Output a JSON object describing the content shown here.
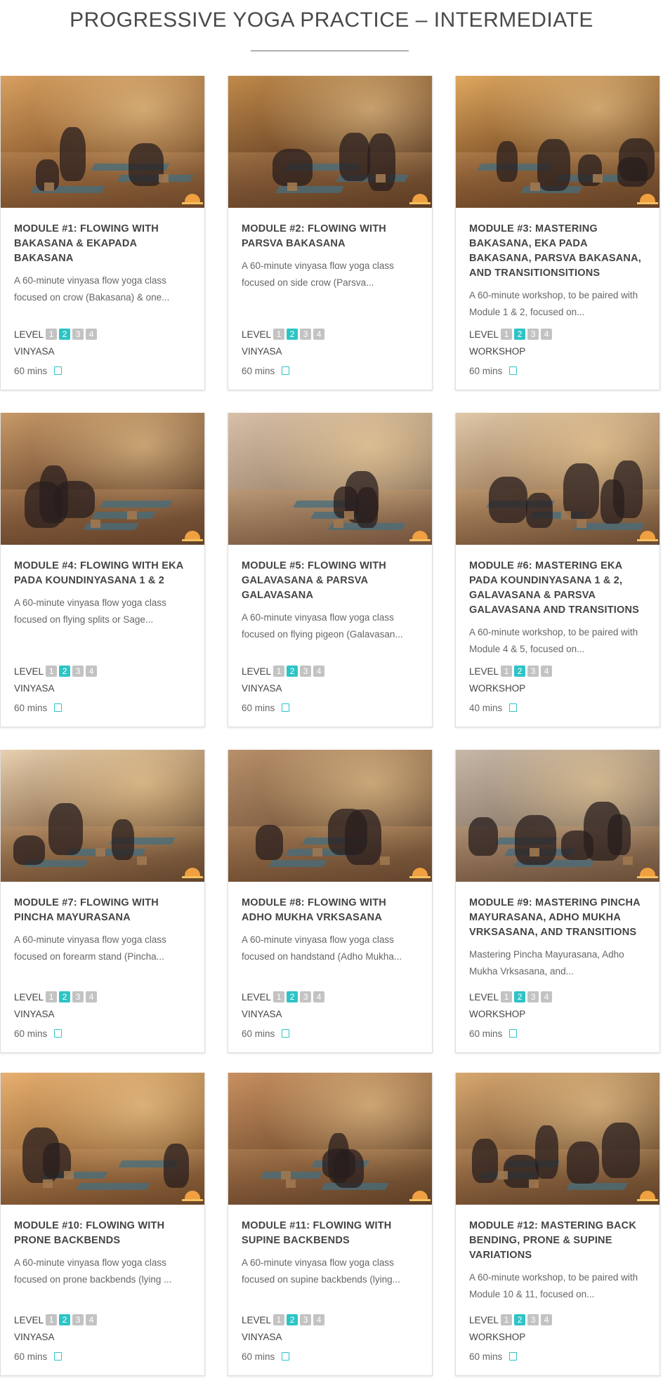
{
  "page": {
    "title": "PROGRESSIVE YOGA PRACTICE – INTERMEDIATE"
  },
  "colors": {
    "accent": "#2ec4c6",
    "level_inactive": "#c3c3c3",
    "text": "#444444"
  },
  "level_label": "LEVEL",
  "level_numbers": [
    "1",
    "2",
    "3",
    "4"
  ],
  "modules": [
    {
      "title": "MODULE #1: FLOWING WITH BAKASANA & EKAPADA BAKASANA",
      "description": "A 60-minute vinyasa flow yoga class focused on crow (Bakasana) & one...",
      "active_level": 2,
      "style": "VINYASA",
      "duration": "60 mins",
      "image_icon": "yoga-class-photo"
    },
    {
      "title": "MODULE #2: FLOWING WITH PARSVA BAKASANA",
      "description": "A 60-minute vinyasa flow yoga class focused on side crow (Parsva...",
      "active_level": 2,
      "style": "VINYASA",
      "duration": "60 mins",
      "image_icon": "yoga-class-photo"
    },
    {
      "title": "MODULE #3: MASTERING BAKASANA, EKA PADA BAKASANA, PARSVA BAKASANA, AND TRANSITIONSITIONS",
      "description": "A 60-minute workshop, to be paired with Module 1 & 2, focused on...",
      "active_level": 2,
      "style": "WORKSHOP",
      "duration": "60 mins",
      "image_icon": "yoga-class-photo"
    },
    {
      "title": "MODULE #4: FLOWING WITH EKA PADA KOUNDINYASANA 1 & 2",
      "description": "A 60-minute vinyasa flow yoga class focused on flying splits or Sage...",
      "active_level": 2,
      "style": "VINYASA",
      "duration": "60 mins",
      "image_icon": "yoga-class-photo"
    },
    {
      "title": "MODULE #5: FLOWING WITH GALAVASANA & PARSVA GALAVASANA",
      "description": "A 60-minute vinyasa flow yoga class focused on flying pigeon (Galavasan...",
      "active_level": 2,
      "style": "VINYASA",
      "duration": "60 mins",
      "image_icon": "yoga-class-photo"
    },
    {
      "title": "MODULE #6: MASTERING EKA PADA KOUNDINYASANA 1 & 2, GALAVASANA & PARSVA GALAVASANA AND TRANSITIONS",
      "description": "A 60-minute workshop, to be paired with Module 4 & 5, focused on...",
      "active_level": 2,
      "style": "WORKSHOP",
      "duration": "40 mins",
      "image_icon": "yoga-class-photo"
    },
    {
      "title": "MODULE #7: FLOWING WITH PINCHA MAYURASANA",
      "description": "A 60-minute vinyasa flow yoga class focused on forearm stand (Pincha...",
      "active_level": 2,
      "style": "VINYASA",
      "duration": "60 mins",
      "image_icon": "yoga-class-photo"
    },
    {
      "title": "MODULE #8: FLOWING WITH ADHO MUKHA VRKSASANA",
      "description": "A 60-minute vinyasa flow yoga class focused on handstand (Adho Mukha...",
      "active_level": 2,
      "style": "VINYASA",
      "duration": "60 mins",
      "image_icon": "yoga-class-photo"
    },
    {
      "title": "MODULE #9: MASTERING PINCHA MAYURASANA, ADHO MUKHA VRKSASANA, AND TRANSITIONS",
      "description": "Mastering Pincha Mayurasana, Adho Mukha Vrksasana, and...",
      "active_level": 2,
      "style": "WORKSHOP",
      "duration": "60 mins",
      "image_icon": "yoga-class-photo"
    },
    {
      "title": "MODULE #10: FLOWING WITH PRONE BACKBENDS",
      "description": "A 60-minute vinyasa flow yoga class focused on prone backbends (lying ...",
      "active_level": 2,
      "style": "VINYASA",
      "duration": "60 mins",
      "image_icon": "yoga-class-photo"
    },
    {
      "title": "MODULE #11: FLOWING WITH SUPINE BACKBENDS",
      "description": "A 60-minute vinyasa flow yoga class focused on supine backbends (lying...",
      "active_level": 2,
      "style": "VINYASA",
      "duration": "60 mins",
      "image_icon": "yoga-class-photo"
    },
    {
      "title": "MODULE #12: MASTERING BACK BENDING, PRONE & SUPINE VARIATIONS",
      "description": "A 60-minute workshop, to be paired with Module 10 & 11, focused on...",
      "active_level": 2,
      "style": "WORKSHOP",
      "duration": "60 mins",
      "image_icon": "yoga-class-photo"
    }
  ]
}
